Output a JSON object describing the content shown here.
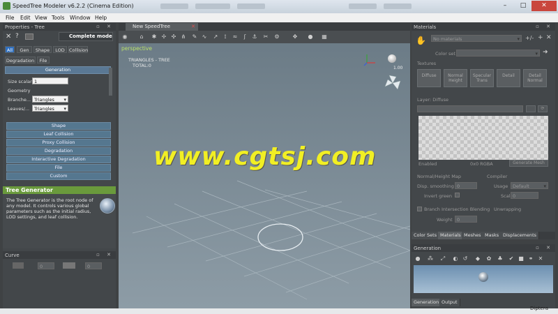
{
  "window": {
    "title": "SpeedTree Modeler v6.2.2 (Cinema Edition)",
    "controls": [
      "–",
      "□",
      "✕"
    ]
  },
  "menubar": [
    "File",
    "Edit",
    "View",
    "Tools",
    "Window",
    "Help"
  ],
  "properties": {
    "header": "Properties - Tree",
    "mode": "Complete mode",
    "tabs": [
      "All",
      "Gen",
      "Shape",
      "LOD",
      "Collision",
      "Degradation",
      "File"
    ],
    "generation_header": "Generation",
    "size_scalar_label": "Size scalar",
    "size_scalar_value": "1",
    "geometry_label": "Geometry",
    "branches_label": "Branche...",
    "branches_value": "Triangles",
    "leaves_label": "Leaves/...",
    "leaves_value": "Triangles",
    "categories": [
      "Shape",
      "Leaf Collision",
      "Proxy Collision",
      "Degradation",
      "Interactive Degradation",
      "File",
      "Custom"
    ]
  },
  "tree_generator": {
    "title": "Tree Generator",
    "description": "The Tree Generator is the root node of any model. It controls various global parameters such as the initial radius, LOD settings, and leaf collision."
  },
  "curve": {
    "header": "Curve",
    "value1": "0",
    "value2": "0"
  },
  "viewport": {
    "tab": "New SpeedTree",
    "mode_label": "perspective",
    "stats_title": "TRIANGLES - TREE",
    "stats_total": "TOTAL:0",
    "zoom_value": "1.00",
    "watermark": "www.cgtsj.com"
  },
  "materials": {
    "header": "Materials",
    "dropdown": "No materials",
    "color_set_label": "Color set",
    "textures_label": "Textures",
    "textures": [
      "Diffuse",
      "Normal Height",
      "Specular Trans",
      "Detail",
      "Detail Normal"
    ],
    "layer_label": "Layer: Diffuse",
    "enabled_label": "Enabled",
    "format_label": "0x0 RGBA",
    "generate_mesh": "Generate Mesh",
    "normal_height_label": "Normal/Height Map",
    "compiler_label": "Compiler",
    "disp_smoothing_label": "Disp. smoothing",
    "disp_smoothing_value": "0",
    "usage_label": "Usage",
    "usage_value": "Default",
    "invert_green_label": "Invert green",
    "scale_label": "Scale",
    "scale_value": "0",
    "branch_blending_label": "Branch Intersection Blending",
    "unwrapping_label": "Unwrapping",
    "weight_label": "Weight",
    "weight_value": "0"
  },
  "bottom_tabs": [
    "Color Sets",
    "Materials",
    "Meshes",
    "Masks",
    "Displacements"
  ],
  "generation": {
    "header": "Generation",
    "tabs": [
      "Generation",
      "Output"
    ]
  },
  "corner_text": "Diptera"
}
